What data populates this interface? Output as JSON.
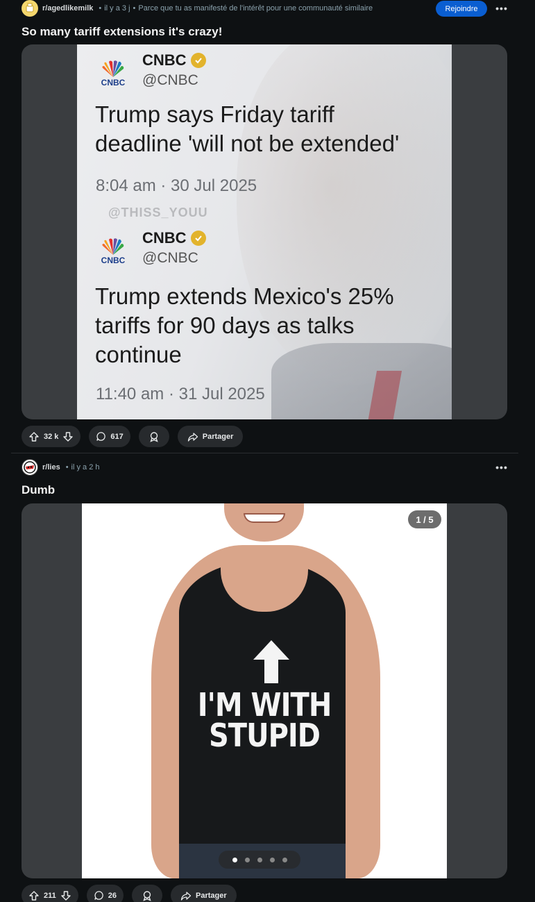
{
  "posts": [
    {
      "subreddit": "r/agedlikemilk",
      "age": "il y a 3 j",
      "reason": "Parce que tu as manifesté de l'intérêt pour une communauté similaire",
      "join_label": "Rejoindre",
      "more_label": "•••",
      "title": "So many tariff extensions it's crazy!",
      "image": {
        "tweets": [
          {
            "logo_text": "CNBC",
            "name": "CNBC",
            "handle": "@CNBC",
            "text_lines": [
              "Trump says Friday tariff",
              "deadline 'will not be extended'"
            ],
            "time": "8:04 am · 30 Jul 2025"
          },
          {
            "logo_text": "CNBC",
            "name": "CNBC",
            "handle": "@CNBC",
            "text_lines": [
              "Trump extends Mexico's 25%",
              "tariffs for 90 days as talks",
              "continue"
            ],
            "time": "11:40 am · 31 Jul 2025"
          }
        ],
        "watermark": "@THISS_YOUU"
      },
      "votes": "32 k",
      "comments": "617",
      "share_label": "Partager"
    },
    {
      "subreddit": "r/lies",
      "age": "il y a 2 h",
      "more_label": "•••",
      "title": "Dumb",
      "image": {
        "counter": "1 / 5",
        "shirt_text_line1": "I'M WITH",
        "shirt_text_line2": "STUPID",
        "gallery_total": 5,
        "gallery_current": 1
      },
      "votes": "211",
      "comments": "26",
      "share_label": "Partager"
    }
  ],
  "colors": {
    "background": "#0e1113",
    "join_button": "#0a5ed1",
    "pill": "#272a2d"
  }
}
